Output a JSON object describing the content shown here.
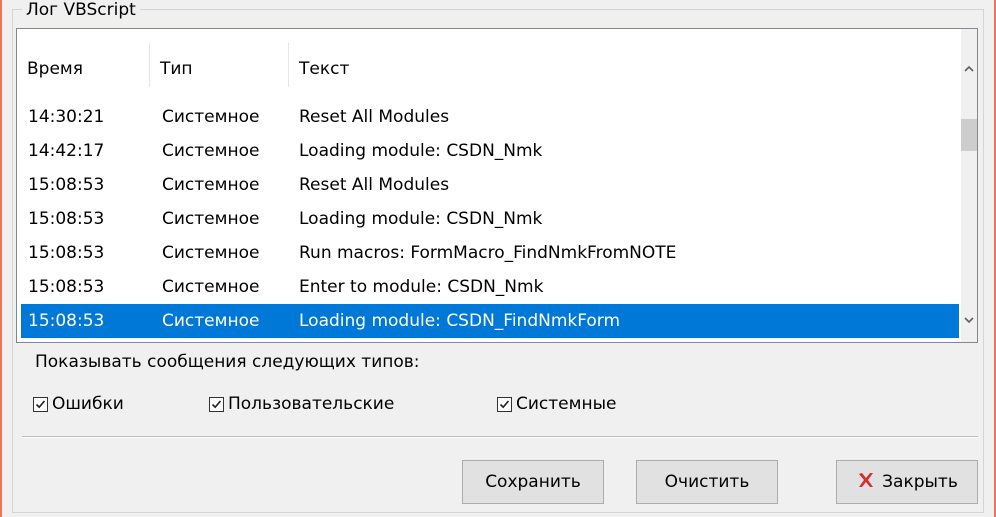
{
  "group": {
    "title": "Лог VBScript"
  },
  "columns": [
    "Время",
    "Тип",
    "Текст"
  ],
  "rows": [
    {
      "time": "14:30:21",
      "type": "Системное",
      "text": "Reset All Modules"
    },
    {
      "time": "14:42:17",
      "type": "Системное",
      "text": "Loading module: CSDN_Nmk"
    },
    {
      "time": "15:08:53",
      "type": "Системное",
      "text": "Reset All Modules"
    },
    {
      "time": "15:08:53",
      "type": "Системное",
      "text": "Loading module: CSDN_Nmk"
    },
    {
      "time": "15:08:53",
      "type": "Системное",
      "text": "Run macros: FormMacro_FindNmkFromNOTE"
    },
    {
      "time": "15:08:53",
      "type": "Системное",
      "text": "Enter to module: CSDN_Nmk"
    },
    {
      "time": "15:08:53",
      "type": "Системное",
      "text": "Loading module: CSDN_FindNmkForm",
      "selected": true
    }
  ],
  "filter": {
    "label": "Показывать сообщения следующих типов:",
    "checkboxes": [
      {
        "label": "Ошибки",
        "checked": true
      },
      {
        "label": "Пользовательские",
        "checked": true
      },
      {
        "label": "Системные",
        "checked": true
      }
    ]
  },
  "buttons": {
    "save": "Сохранить",
    "clear": "Очистить",
    "close": "Закрыть"
  },
  "icons": {
    "scroll_up": "chevron-up-icon",
    "scroll_down": "chevron-down-icon",
    "close": "red-x-icon"
  },
  "colors": {
    "selection": "#0078d7",
    "close_icon": "#d32f2f",
    "window_accent": "#e8765a"
  }
}
